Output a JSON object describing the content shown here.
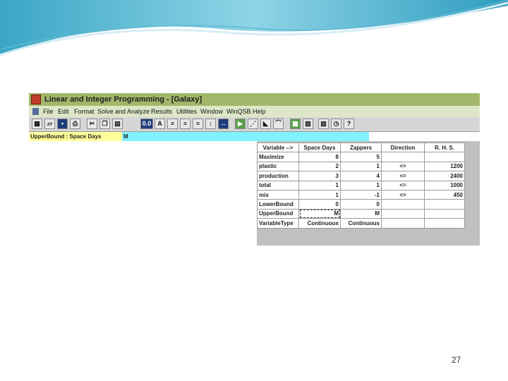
{
  "window": {
    "title": "Linear and Integer Programming - [Galaxy]"
  },
  "menu": [
    "File",
    "Edit",
    "Format",
    "Solve and Analyze",
    "Results",
    "Utilities",
    "Window",
    "WinQSB",
    "Help"
  ],
  "toolbar_icons": [
    "grid-icon",
    "open-icon",
    "save-icon",
    "print-icon",
    "cut-icon",
    "copy-icon",
    "paste-icon",
    "font-size-icon",
    "font-icon",
    "align-left-icon",
    "align-center-icon",
    "align-right-icon",
    "row-height-icon",
    "column-width-icon",
    "solve-icon",
    "step-icon",
    "graph-icon",
    "curve-icon",
    "table-icon",
    "chart-icon",
    "bar-chart-icon",
    "clock-icon",
    "help-icon"
  ],
  "formula_bar": {
    "cell_ref": "UpperBound : Space Days",
    "value": "M"
  },
  "table": {
    "headers": [
      "Variable -->",
      "Space Days",
      "Zappers",
      "Direction",
      "R. H. S."
    ],
    "rows": [
      [
        "Maximize",
        "8",
        "5",
        "",
        ""
      ],
      [
        "plastic",
        "2",
        "1",
        "<=",
        "1200"
      ],
      [
        "production",
        "3",
        "4",
        "<=",
        "2400"
      ],
      [
        "total",
        "1",
        "1",
        "<=",
        "1000"
      ],
      [
        "mix",
        "1",
        "-1",
        "<=",
        "450"
      ],
      [
        "LowerBound",
        "0",
        "0",
        "",
        ""
      ],
      [
        "UpperBound",
        "M",
        "M",
        "",
        ""
      ],
      [
        "VariableType",
        "Continuous",
        "Continuous",
        "",
        ""
      ]
    ]
  },
  "page_number": "27"
}
